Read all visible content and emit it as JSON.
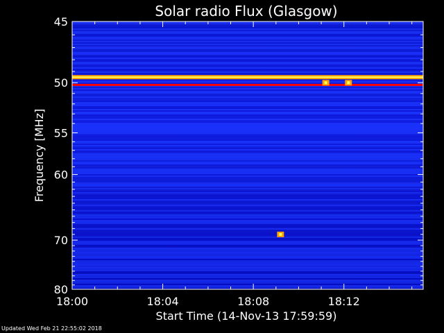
{
  "chart_data": {
    "type": "heatmap",
    "title": "Solar radio Flux (Glasgow)",
    "xlabel": "Start Time (14-Nov-13 17:59:59)",
    "ylabel": "Frequency [MHz]",
    "x_ticks": [
      "18:00",
      "18:04",
      "18:08",
      "18:12"
    ],
    "x_tick_minutes": [
      0,
      4,
      8,
      12
    ],
    "xlim_minutes": [
      0,
      15.5
    ],
    "y_ticks": [
      45,
      50,
      55,
      60,
      70,
      80
    ],
    "ylim": [
      45,
      80
    ],
    "colormap": [
      "#0000c8",
      "#1a32ff",
      "#ff0000",
      "#ffa000",
      "#ffff60"
    ],
    "features": [
      {
        "kind": "band",
        "freq_mhz": 49.5,
        "intensity": "high"
      },
      {
        "kind": "band",
        "freq_mhz": 50.2,
        "intensity": "medium"
      },
      {
        "kind": "burst",
        "minute": 9.2,
        "freq_mhz": 69.0
      },
      {
        "kind": "burst",
        "minute": 11.2,
        "freq_mhz": 50.0
      },
      {
        "kind": "burst",
        "minute": 12.2,
        "freq_mhz": 50.0
      }
    ]
  },
  "footer": "Updated Wed Feb 21 22:55:02 2018"
}
